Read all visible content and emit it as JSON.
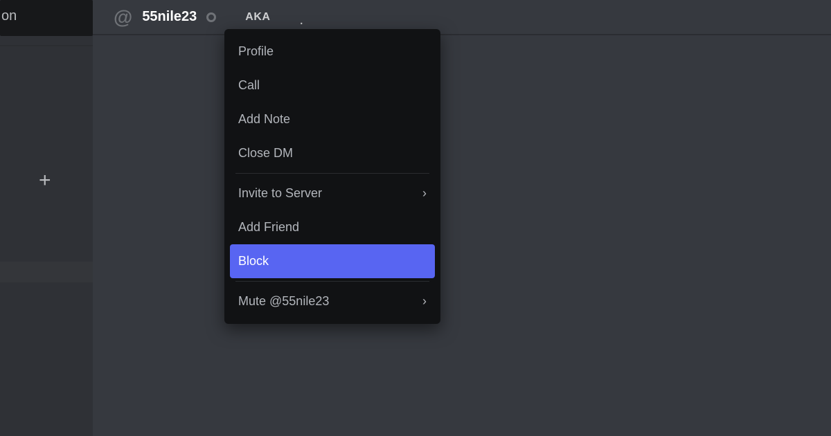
{
  "sidebar": {
    "fragment_text": "on",
    "add_glyph": "+"
  },
  "header": {
    "at_glyph": "@",
    "username": "55nile23",
    "aka_label": "AKA",
    "aka_dot": "."
  },
  "menu": {
    "profile": "Profile",
    "call": "Call",
    "add_note": "Add Note",
    "close_dm": "Close DM",
    "invite": "Invite to Server",
    "add_friend": "Add Friend",
    "block": "Block",
    "mute": "Mute @55nile23",
    "chevron": "›"
  }
}
